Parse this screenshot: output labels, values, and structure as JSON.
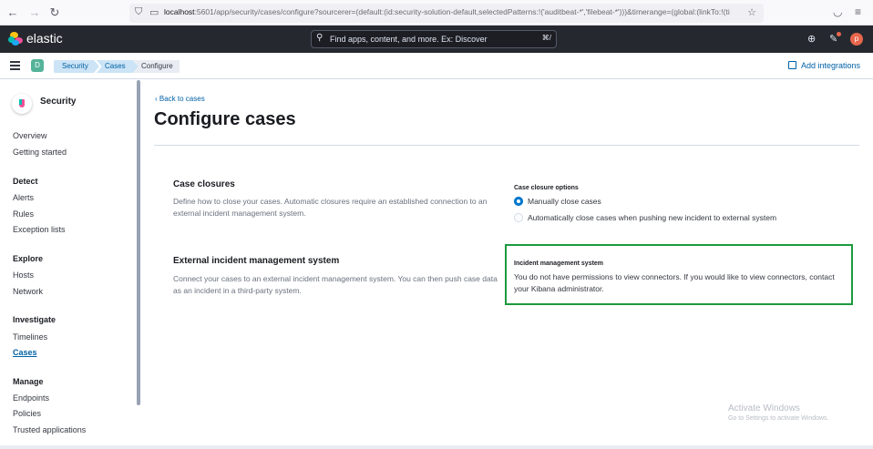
{
  "browser": {
    "url_host": "localhost",
    "url_rest": ":5601/app/security/cases/configure?sourcerer=(default:(id:security-solution-default,selectedPatterns:!('auditbeat-*','filebeat-*')))&timerange=(global:(linkTo:!(ti"
  },
  "header": {
    "brand": "elastic",
    "search_placeholder": "Find apps, content, and more. Ex: Discover",
    "search_shortcut": "⌘/",
    "avatar_initial": "p"
  },
  "breadcrumbs": {
    "space_initial": "D",
    "items": [
      "Security",
      "Cases",
      "Configure"
    ],
    "add_integrations": "Add integrations"
  },
  "sidebar": {
    "title": "Security",
    "overview": "Overview",
    "getting_started": "Getting started",
    "detect": "Detect",
    "alerts": "Alerts",
    "rules": "Rules",
    "exception_lists": "Exception lists",
    "explore": "Explore",
    "hosts": "Hosts",
    "network": "Network",
    "investigate": "Investigate",
    "timelines": "Timelines",
    "cases": "Cases",
    "manage": "Manage",
    "endpoints": "Endpoints",
    "policies": "Policies",
    "trusted_applications": "Trusted applications"
  },
  "main": {
    "back_link": "Back to cases",
    "title": "Configure cases",
    "closures_title": "Case closures",
    "closures_desc": "Define how to close your cases. Automatic closures require an established connection to an external incident management system.",
    "closure_options_label": "Case closure options",
    "option_manual": "Manually close cases",
    "option_auto": "Automatically close cases when pushing new incident to external system",
    "selected_option": "Manually close cases",
    "ims_title": "External incident management system",
    "ims_desc": "Connect your cases to an external incident management system. You can then push case data as an incident in a third-party system.",
    "ims_label": "Incident management system",
    "ims_message": "You do not have permissions to view connectors. If you would like to view connectors, contact your Kibana administrator."
  },
  "watermark": {
    "line1": "Activate Windows",
    "line2": "Go to Settings to activate Windows."
  },
  "colors": {
    "accent": "#0077cc",
    "header_bg": "#25282f",
    "highlight_border": "#1d9a3e"
  }
}
